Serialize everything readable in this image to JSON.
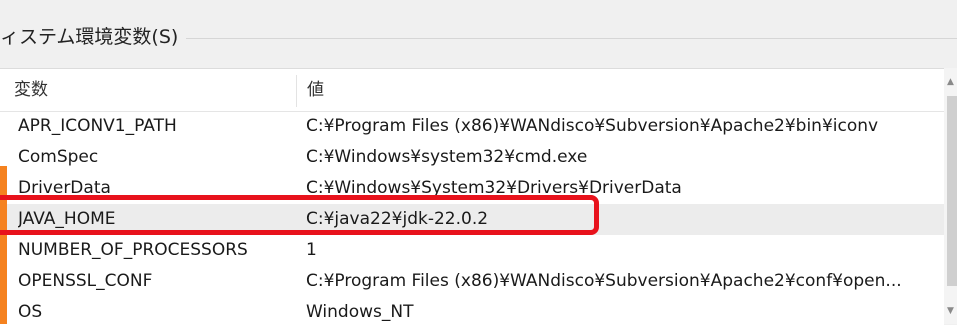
{
  "groupbox": {
    "title": "ィステム環境変数(S)"
  },
  "listview": {
    "columns": {
      "name": "変数",
      "value": "値"
    },
    "rows": [
      {
        "name": "APR_ICONV1_PATH",
        "value": "C:¥Program Files (x86)¥WANdisco¥Subversion¥Apache2¥bin¥iconv"
      },
      {
        "name": "ComSpec",
        "value": "C:¥Windows¥system32¥cmd.exe"
      },
      {
        "name": "DriverData",
        "value": "C:¥Windows¥System32¥Drivers¥DriverData"
      },
      {
        "name": "JAVA_HOME",
        "value": "C:¥java22¥jdk-22.0.2"
      },
      {
        "name": "NUMBER_OF_PROCESSORS",
        "value": "1"
      },
      {
        "name": "OPENSSL_CONF",
        "value": "C:¥Program Files (x86)¥WANdisco¥Subversion¥Apache2¥conf¥open..."
      },
      {
        "name": "OS",
        "value": "Windows_NT"
      }
    ],
    "selected_row": "JAVA_HOME"
  },
  "scrollbar": {
    "up_icon": "scroll-up-arrow",
    "down_icon": "scroll-down-arrow"
  },
  "colors": {
    "highlight_box": "#e8121c",
    "left_marker": "#f58220",
    "selected_row": "#ececec"
  }
}
